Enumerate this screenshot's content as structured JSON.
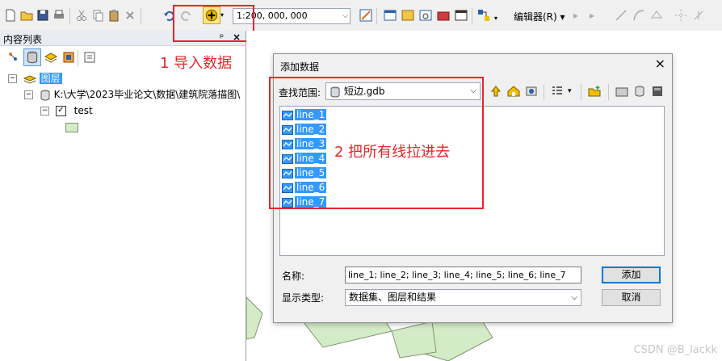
{
  "toolbar": {
    "scale_value": "1:200, 000, 000",
    "editor_label": "编辑器(R)"
  },
  "left_panel": {
    "title": "内容列表",
    "pin": "ᵖ",
    "close": "×",
    "tree": {
      "layers_label": "图层",
      "path_label": "K:\\大学\\2023毕业论文\\数据\\建筑院落描图\\",
      "layer_name": "test"
    }
  },
  "dialog": {
    "title": "添加数据",
    "close": "×",
    "lookin_label": "查找范围:",
    "lookin_value": "短边.gdb",
    "files": [
      "line_1",
      "line_2",
      "line_3",
      "line_4",
      "line_5",
      "line_6",
      "line_7"
    ],
    "name_label": "名称:",
    "name_value": "line_1; line_2; line_3; line_4; line_5; line_6; line_7",
    "type_label": "显示类型:",
    "type_value": "数据集、图层和结果",
    "add_button": "添加",
    "cancel_button": "取消"
  },
  "annotations": {
    "step1": "1 导入数据",
    "step2": "2 把所有线拉进去",
    "color": "#e8262a"
  },
  "watermark": "CSDN @B_lackk",
  "colors": {
    "selection": "#3399ff",
    "polygon_fill": "#d4ebc8",
    "polygon_stroke": "#7f9670"
  }
}
